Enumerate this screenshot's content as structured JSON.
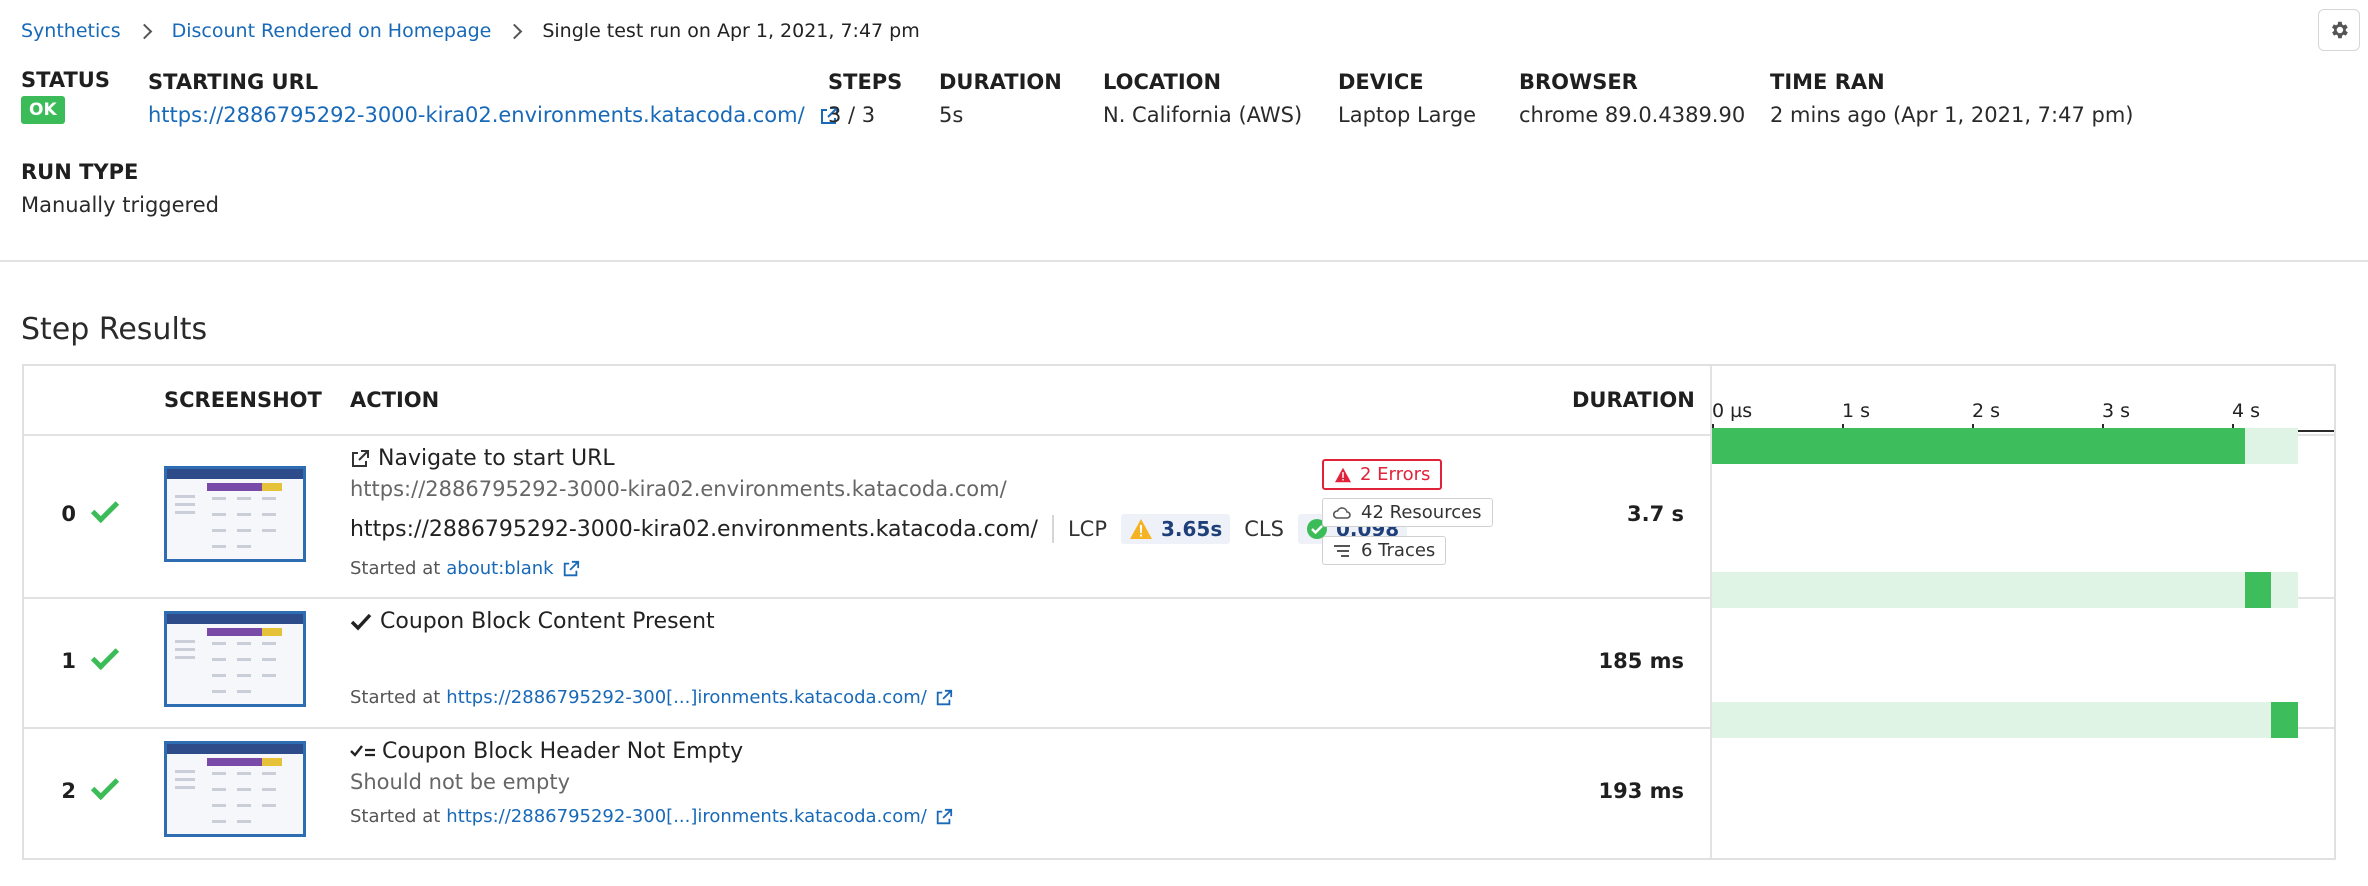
{
  "breadcrumb": {
    "items": [
      "Synthetics",
      "Discount Rendered on Homepage"
    ],
    "current": "Single test run on Apr 1, 2021, 7:47 pm"
  },
  "meta": {
    "status_label": "STATUS",
    "status_value": "OK",
    "starting_url_label": "STARTING URL",
    "starting_url": "https://2886795292-3000-kira02.environments.katacoda.com/",
    "steps_label": "STEPS",
    "steps_value": "3 / 3",
    "duration_label": "DURATION",
    "duration_value": "5s",
    "location_label": "LOCATION",
    "location_value": "N. California (AWS)",
    "device_label": "DEVICE",
    "device_value": "Laptop Large",
    "browser_label": "BROWSER",
    "browser_value": "chrome 89.0.4389.90",
    "time_ran_label": "TIME RAN",
    "time_ran_value": "2 mins ago (Apr 1, 2021, 7:47 pm)",
    "run_type_label": "RUN TYPE",
    "run_type_value": "Manually triggered"
  },
  "step_results": {
    "title": "Step Results",
    "columns": {
      "screenshot": "SCREENSHOT",
      "action": "ACTION",
      "duration": "DURATION"
    },
    "timeline_ticks": [
      "0 µs",
      "1 s",
      "2 s",
      "3 s",
      "4 s"
    ],
    "steps": [
      {
        "index": "0",
        "status": "passed",
        "icon": "external-link-icon",
        "title": "Navigate to start URL",
        "subtitle": "https://2886795292-3000-kira02.environments.katacoda.com/",
        "url": "https://2886795292-3000-kira02.environments.katacoda.com/",
        "lcp_label": "LCP",
        "lcp_value": "3.65s",
        "cls_label": "CLS",
        "cls_value": "0.098",
        "started_label": "Started at",
        "started_link": "about:blank",
        "errors": "2 Errors",
        "resources": "42 Resources",
        "traces": "6 Traces",
        "duration": "3.7 s",
        "bar_start_s": 0,
        "bar_end_s": 4.12
      },
      {
        "index": "1",
        "status": "passed",
        "icon": "checkmark-icon",
        "title": "Coupon Block Content Present",
        "started_label": "Started at",
        "started_link": "https://2886795292-300[...]ironments.katacoda.com/",
        "duration": "185 ms",
        "bar_start_s": 4.12,
        "bar_end_s": 4.32
      },
      {
        "index": "2",
        "status": "passed",
        "icon": "assertion-icon",
        "title": "Coupon Block Header Not Empty",
        "subtitle": "Should not be empty",
        "started_label": "Started at",
        "started_link": "https://2886795292-300[...]ironments.katacoda.com/",
        "duration": "193 ms",
        "bar_start_s": 4.32,
        "bar_end_s": 4.53
      }
    ],
    "timeline_total_s": 4.53
  },
  "colors": {
    "link": "#1869b8",
    "ok": "#3cbc58",
    "error": "#e0233a",
    "bar": "#3dbd5b",
    "bar_bg": "#e0f4e5",
    "warning": "#f5b324"
  }
}
